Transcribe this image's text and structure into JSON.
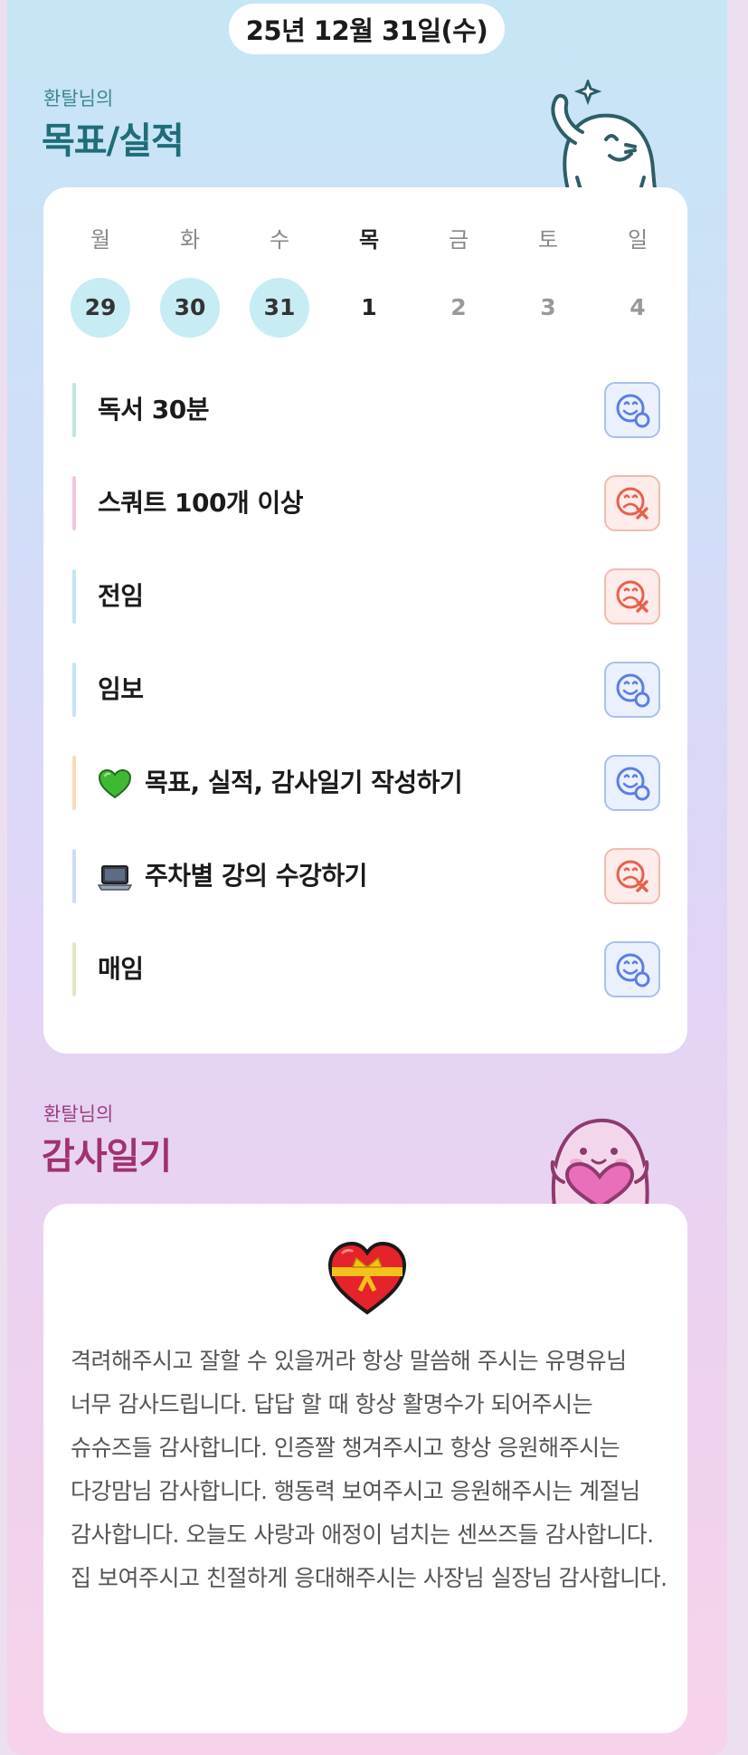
{
  "header": {
    "date": "25년 12월 31일(수)"
  },
  "goals_section": {
    "owner_label": "환탈님의",
    "title": "목표/실적",
    "weekdays": [
      "월",
      "화",
      "수",
      "목",
      "금",
      "토",
      "일"
    ],
    "dates": [
      {
        "day": "29",
        "state": "done"
      },
      {
        "day": "30",
        "state": "done"
      },
      {
        "day": "31",
        "state": "done"
      },
      {
        "day": "1",
        "state": "today"
      },
      {
        "day": "2",
        "state": "future"
      },
      {
        "day": "3",
        "state": "future"
      },
      {
        "day": "4",
        "state": "future"
      }
    ],
    "items": [
      {
        "label": "독서 30분",
        "emoji": "",
        "bar_color": "#bfe6e0",
        "status": "ok"
      },
      {
        "label": "스쿼트 100개 이상",
        "emoji": "",
        "bar_color": "#f4c3dd",
        "status": "fail"
      },
      {
        "label": "전임",
        "emoji": "",
        "bar_color": "#c3e5f2",
        "status": "fail"
      },
      {
        "label": "임보",
        "emoji": "",
        "bar_color": "#c3e5f2",
        "status": "ok"
      },
      {
        "label": "목표, 실적, 감사일기 작성하기",
        "emoji": "green-heart-icon",
        "bar_color": "#f8dbb8",
        "status": "ok"
      },
      {
        "label": "주차별 강의 수강하기",
        "emoji": "laptop-icon",
        "bar_color": "#cfdcf6",
        "status": "fail"
      },
      {
        "label": "매임",
        "emoji": "",
        "bar_color": "#dceac4",
        "status": "ok"
      }
    ]
  },
  "diary_section": {
    "owner_label": "환탈님의",
    "title": "감사일기",
    "heart_icon": "heart-with-ribbon-icon",
    "text": "격려해주시고 잘할 수 있을꺼라 항상 말씀해 주시는 유명유님 너무 감사드립니다. 답답 할 때 항상 활명수가 되어주시는 슈슈즈들 감사합니다. 인증짤 챙겨주시고 항상 응원해주시는 다강맘님 감사합니다. 행동력 보여주시고 응원해주시는 계절님 감사합니다. 오늘도 사랑과 애정이 넘치는 센쓰즈들 감사합니다. 집 보여주시고 친절하게 응대해주시는 사장님 실장님 감사합니다."
  },
  "colors": {
    "ok_icon": "#5b7fe3",
    "fail_icon": "#e8604c",
    "done_date": "#c7ecf3",
    "title_teal": "#1e6d78",
    "title_pink": "#a0326f"
  }
}
